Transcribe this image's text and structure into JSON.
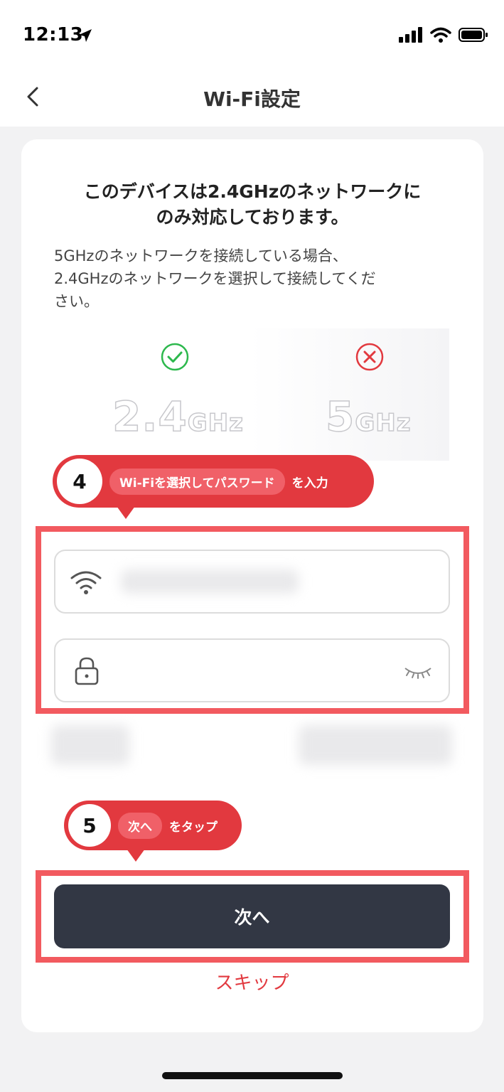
{
  "status_bar": {
    "time": "12:13"
  },
  "nav": {
    "title": "Wi-Fi設定"
  },
  "card": {
    "headline_line1": "このデバイスは2.4GHzのネットワークに",
    "headline_line2": "のみ対応しております。",
    "desc_line1": "5GHzのネットワークを接続している場合、",
    "desc_line2": "2.4GHzのネットワークを選択して接続してくだ",
    "desc_line3": "さい。",
    "freq_supported_number": "2.4",
    "freq_unsupported_number": "5",
    "freq_unit": "GHz"
  },
  "step4": {
    "number": "4",
    "pill": "Wi-Fiを選択してパスワード",
    "tail": "を入力"
  },
  "step5": {
    "number": "5",
    "pill": "次へ",
    "tail": "をタップ"
  },
  "buttons": {
    "next": "次へ",
    "skip": "スキップ"
  },
  "icons": {
    "back": "chevron-left-icon",
    "location": "location-arrow-icon",
    "signal": "cellular-signal-icon",
    "wifi_status": "wifi-icon",
    "battery": "battery-icon",
    "check": "check-circle-icon",
    "cross": "x-circle-icon",
    "wifi_field": "wifi-icon",
    "lock": "lock-icon",
    "eye": "eye-closed-icon"
  },
  "colors": {
    "accent_red": "#e2393f",
    "highlight_red": "#f25a5f",
    "check_green": "#2db84d",
    "button_dark": "#323744"
  }
}
